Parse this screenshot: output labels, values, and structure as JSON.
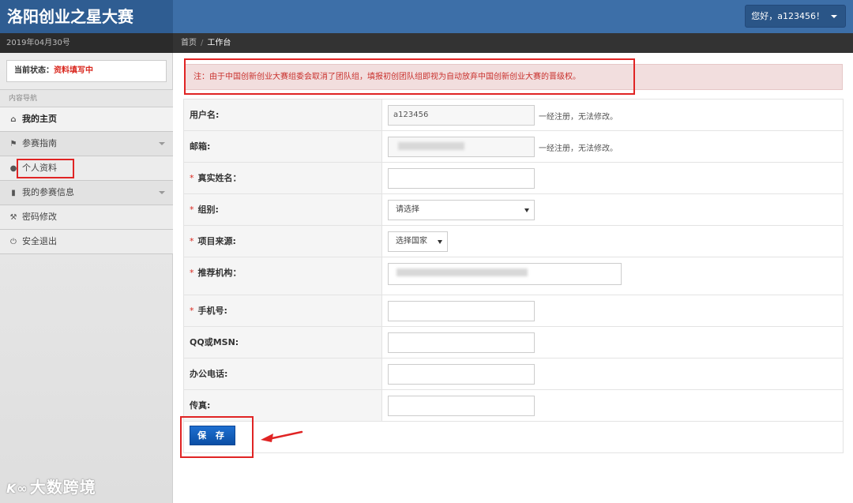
{
  "header": {
    "app_title": "洛阳创业之星大赛",
    "user_greeting": "您好，a123456！"
  },
  "subbar": {
    "date": "2019年04月30号",
    "breadcrumb_home": "首页",
    "breadcrumb_sep": "/",
    "breadcrumb_current": "工作台"
  },
  "sidebar": {
    "status_label": "当前状态：",
    "status_value": "资料填写中",
    "nav_header": "内容导航",
    "items": [
      {
        "label": "我的主页",
        "icon": "home-icon"
      },
      {
        "label": "参赛指南",
        "icon": "flag-icon"
      },
      {
        "label": "个人资料",
        "icon": "user-icon"
      },
      {
        "label": "我的参赛信息",
        "icon": "file-icon"
      },
      {
        "label": "密码修改",
        "icon": "wrench-icon"
      },
      {
        "label": "安全退出",
        "icon": "power-icon"
      }
    ],
    "watermark": "大数跨境"
  },
  "notice": "注：由于中国创新创业大赛组委会取消了团队组，填报初创团队组即视为自动放弃中国创新创业大赛的晋级权。",
  "form": {
    "username_label": "用户名:",
    "username_value": "a123456",
    "username_hint": "一经注册，无法修改。",
    "email_label": "邮箱:",
    "email_hint": "一经注册，无法修改。",
    "realname_label": "真实姓名：",
    "group_label": "组别:",
    "group_selected": "请选择",
    "source_label": "项目来源:",
    "source_selected": "选择国家",
    "org_label": "推荐机构：",
    "phone_label": "手机号:",
    "qq_label": "QQ或MSN:",
    "office_phone_label": "办公电话:",
    "fax_label": "传真:",
    "required_mark": "*"
  },
  "save_label": "保 存",
  "colors": {
    "header_bg": "#3d6fa8",
    "logo_bg": "#2f5d92",
    "status_red": "#d9281f",
    "notice_bg": "#f2dede",
    "save_blue": "#1e6fd0",
    "annotation_red": "#e02424"
  }
}
